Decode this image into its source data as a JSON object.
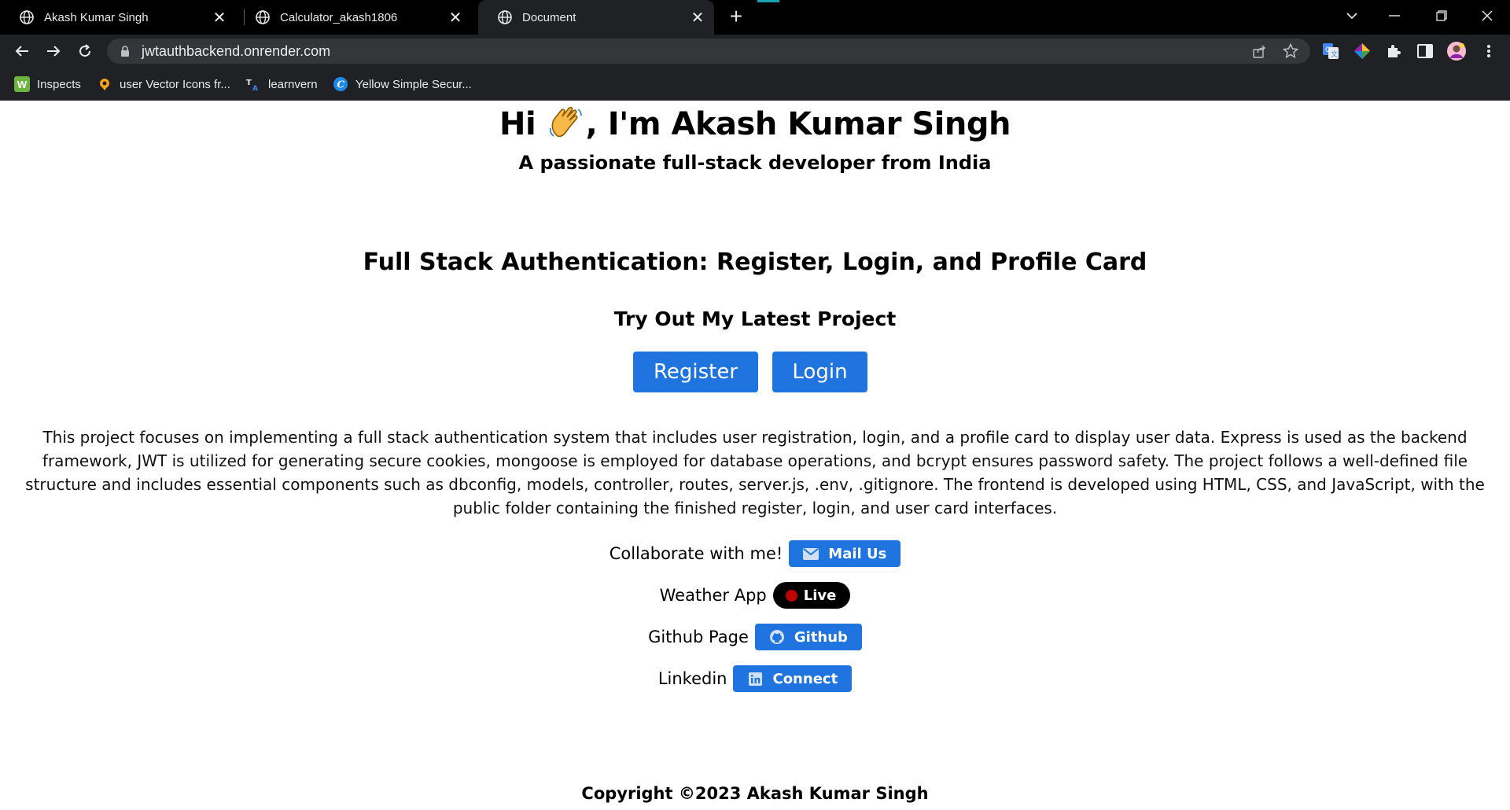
{
  "browser": {
    "tabs": [
      {
        "title": "Akash Kumar Singh",
        "active": false
      },
      {
        "title": "Calculator_akash1806",
        "active": false
      },
      {
        "title": "Document",
        "active": true
      }
    ],
    "new_tab": "+",
    "url": "jwtauthbackend.onrender.com",
    "bookmarks": [
      {
        "label": "Inspects",
        "icon": "inspects-icon",
        "icon_color": "#6db33f"
      },
      {
        "label": "user Vector Icons fr...",
        "icon": "pin-icon",
        "icon_color": "#f4a31b"
      },
      {
        "label": "learnvern",
        "icon": "learnvern-icon",
        "icon_color": "#3b82f6"
      },
      {
        "label": "Yellow Simple Secur...",
        "icon": "canva-icon",
        "icon_color": "#1e88e5"
      }
    ]
  },
  "page": {
    "hero_prefix": "Hi",
    "hero_suffix": ", I'm Akash Kumar Singh",
    "subtitle": "A passionate full-stack developer from India",
    "project_title": "Full Stack Authentication: Register, Login, and Profile Card",
    "try_out": "Try Out My Latest Project",
    "register_label": "Register",
    "login_label": "Login",
    "description": "This project focuses on implementing a full stack authentication system that includes user registration, login, and a profile card to display user data. Express is used as the backend framework, JWT is utilized for generating secure cookies, mongoose is employed for database operations, and bcrypt ensures password safety. The project follows a well-defined file structure and includes essential components such as dbconfig, models, controller, routes, server.js, .env, .gitignore. The frontend is developed using HTML, CSS, and JavaScript, with the public folder containing the finished register, login, and user card interfaces.",
    "links": [
      {
        "label": "Collaborate with me!",
        "button": "Mail Us",
        "icon": "mail-icon"
      },
      {
        "label": "Weather App",
        "button": "Live",
        "icon": "live-dot-icon"
      },
      {
        "label": "Github Page",
        "button": "Github",
        "icon": "github-icon"
      },
      {
        "label": "Linkedin",
        "button": "Connect",
        "icon": "linkedin-icon"
      }
    ],
    "copyright": "Copyright ©2023 Akash Kumar Singh"
  },
  "colors": {
    "accent": "#1f74e0",
    "live_dot": "#c00000",
    "chrome_bg": "#202124",
    "tabbar_bg": "#000000"
  }
}
